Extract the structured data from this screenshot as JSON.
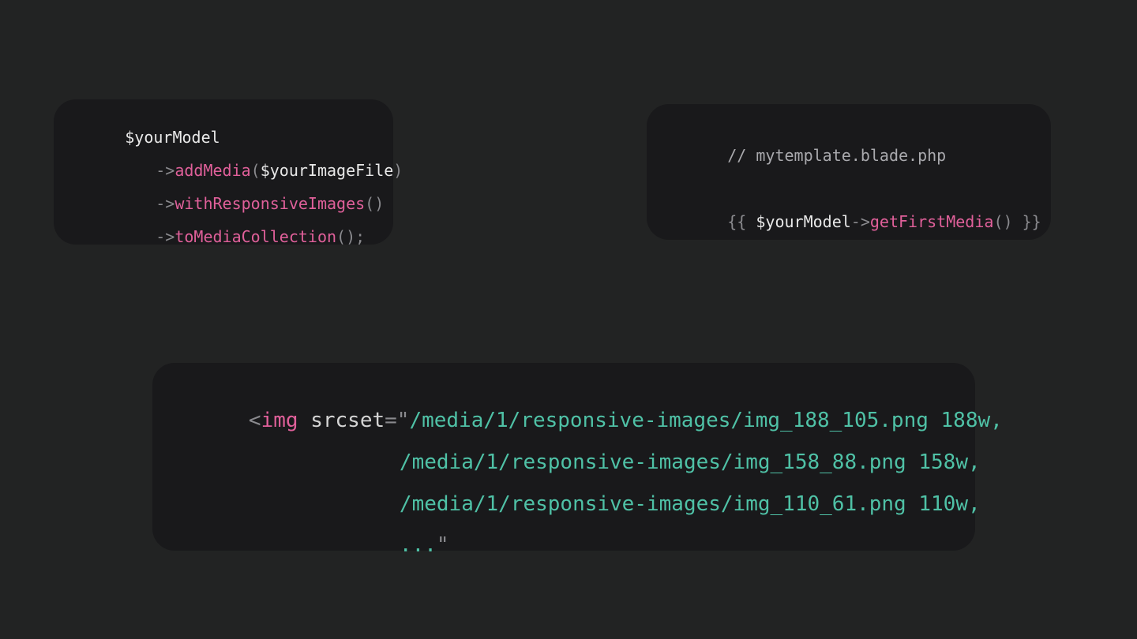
{
  "colors": {
    "background": "#222323",
    "card": "#19191b",
    "variable": "#e8e8e8",
    "punctuation": "#8a8a8e",
    "function": "#e0609a",
    "string": "#4fc1a6",
    "comment": "#a9a9ad"
  },
  "model_snippet": {
    "var": "$yourModel",
    "arrow": "->",
    "add_media": "addMedia",
    "open_paren": "(",
    "image_arg": "$yourImageFile",
    "close_paren": ")",
    "with_responsive": "withResponsiveImages",
    "empty_parens": "()",
    "to_collection": "toMediaCollection",
    "terminator": "();"
  },
  "template_snippet": {
    "comment": "// mytemplate.blade.php",
    "open_braces": "{{ ",
    "var": "$yourModel",
    "arrow": "->",
    "method": "getFirstMedia",
    "parens": "()",
    "close_braces": " }}"
  },
  "img_snippet": {
    "lt": "<",
    "tag": "img",
    "space": " ",
    "attr": "srcset",
    "eq_quote": "=\"",
    "src_1": "/media/1/responsive-images/img_188_105.png 188w,",
    "src_2": "/media/1/responsive-images/img_158_88.png 158w,",
    "src_3": "/media/1/responsive-images/img_110_61.png 110w,",
    "ellipsis": "...",
    "close_quote": "\""
  }
}
